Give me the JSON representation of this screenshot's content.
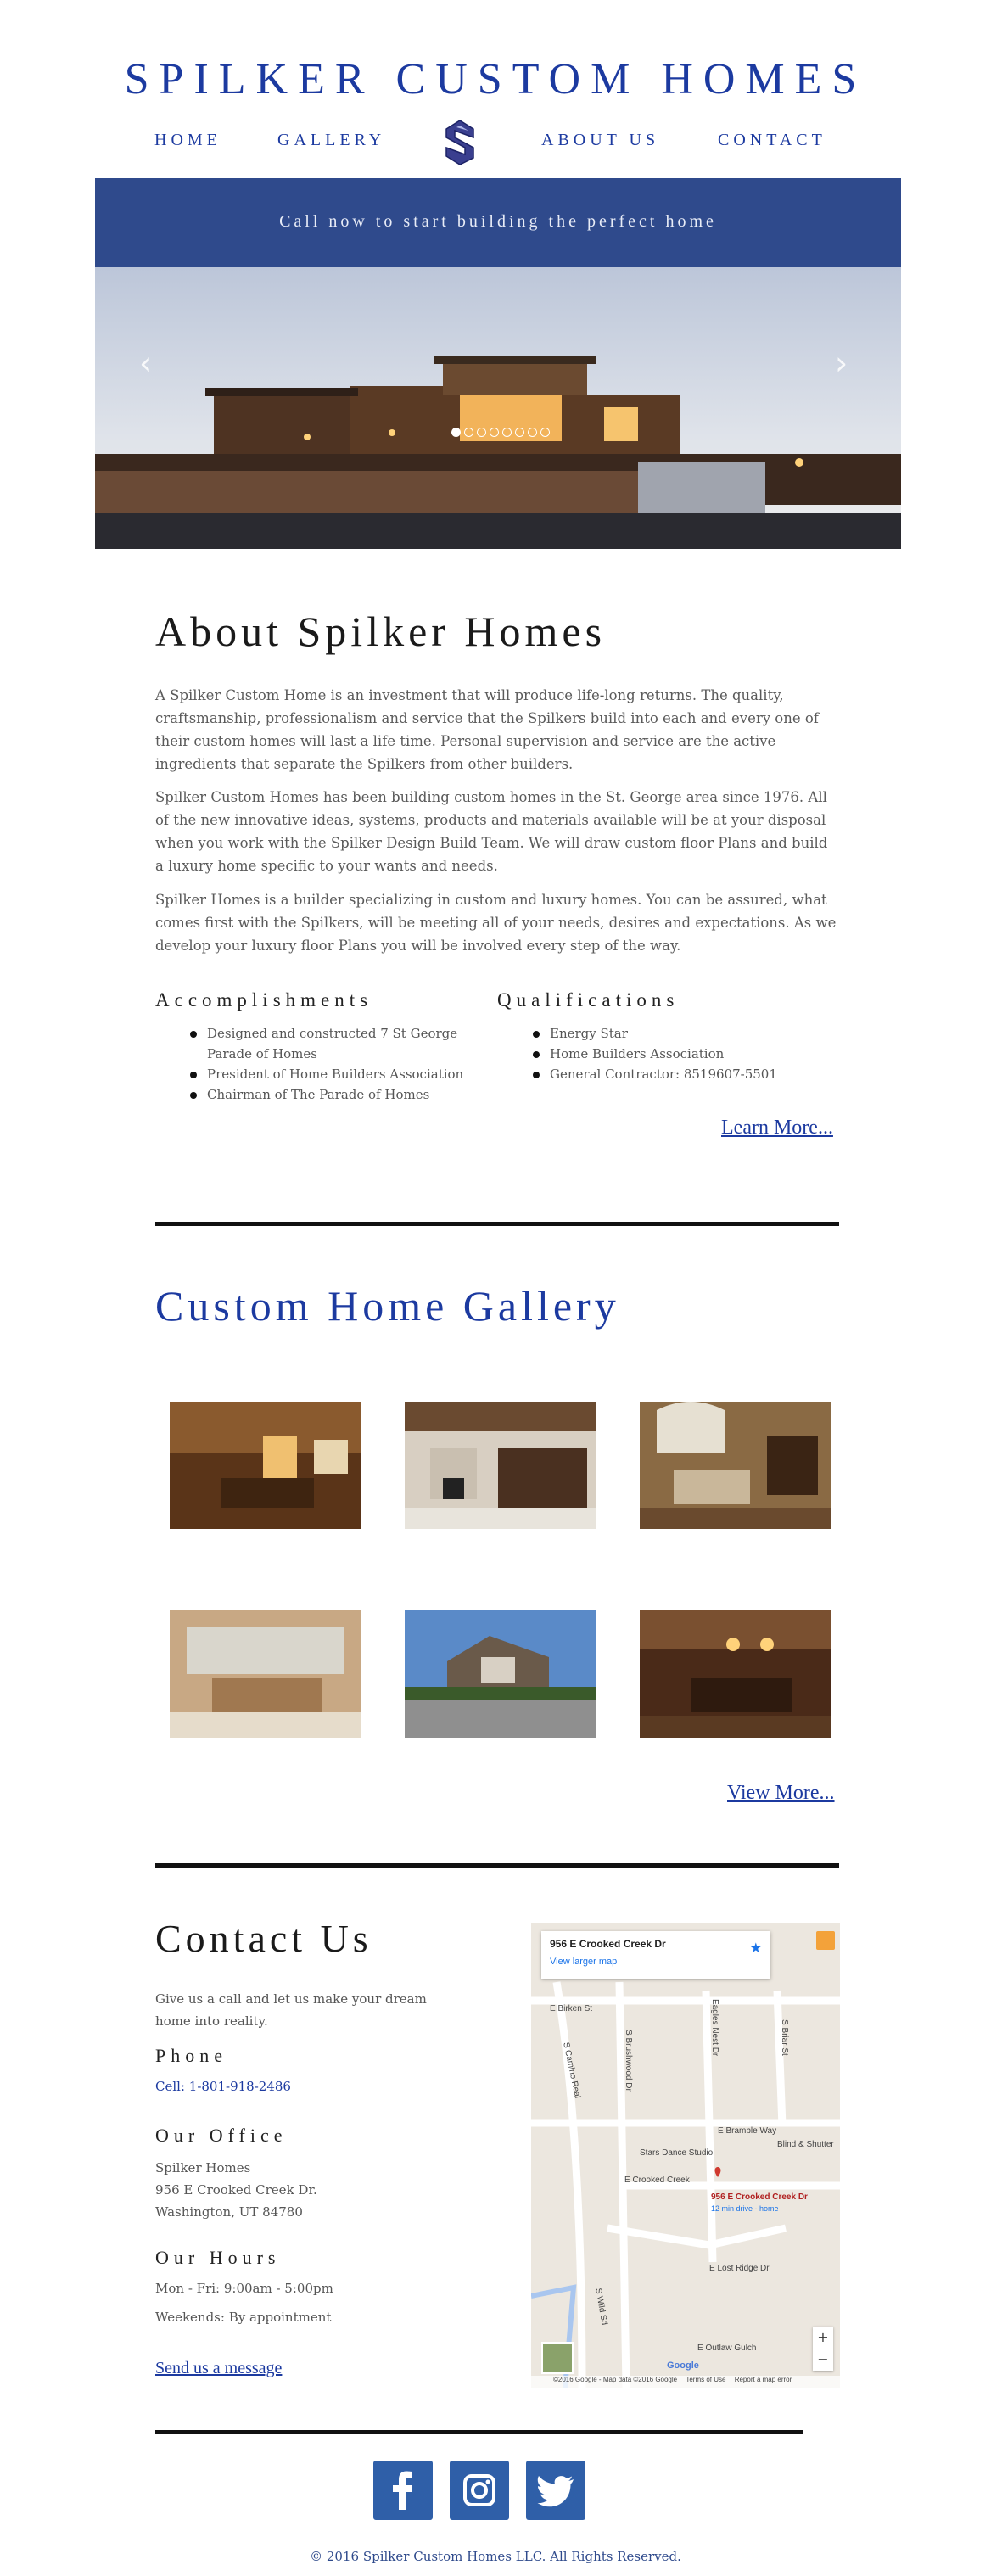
{
  "brand": {
    "title": "SPILKER CUSTOM HOMES"
  },
  "nav": {
    "home": "HOME",
    "gallery": "GALLERY",
    "about": "ABOUT US",
    "contact": "CONTACT"
  },
  "hero": {
    "banner": "Call now to start building the perfect home",
    "slide_count": 8,
    "active_slide": 1
  },
  "about": {
    "title": "About Spilker Homes",
    "p1": "A Spilker Custom Home is an investment that will produce life-long returns. The quality, craftsmanship, professionalism and service that the Spilkers build into each and every one of their custom homes will last a life time. Personal supervision and service are the active ingredients that separate the Spilkers from other builders.",
    "p2": "Spilker Custom Homes has been building custom homes in the St. George area since 1976. All of the new innovative ideas, systems, products and materials available will be at your disposal when you work with the Spilker Design Build Team. We will draw custom floor Plans and build a luxury home specific to your wants and needs.",
    "p3": "Spilker Homes is a builder specializing in custom and luxury homes. You can be assured, what comes first with the Spilkers, will be meeting all of your needs, desires and expectations. As we develop your luxury floor Plans you will be involved every step of the way.",
    "accomplishments_title": "Accomplishments",
    "accomplishments": [
      "Designed and constructed 7 St George Parade of Homes",
      "President of Home Builders Association",
      "Chairman of The Parade of Homes"
    ],
    "qualifications_title": "Qualifications",
    "qualifications": [
      "Energy Star",
      "Home Builders Association",
      "General Contractor: 8519607-5501"
    ],
    "learn_more": "Learn More..."
  },
  "gallery": {
    "title": "Custom Home Gallery",
    "view_more": "View More..."
  },
  "contact": {
    "title": "Contact Us",
    "intro": "Give us a call and let us make your dream home into reality.",
    "phone_title": "Phone",
    "phone": "Cell: 1-801-918-2486",
    "office_title": "Our Office",
    "office_lines": [
      "Spilker Homes",
      "956 E Crooked Creek Dr.",
      "Washington, UT 84780"
    ],
    "hours_title": "Our Hours",
    "hours_weekday": "Mon - Fri: 9:00am - 5:00pm",
    "hours_weekend": "Weekends: By appointment",
    "message_link": "Send us a message"
  },
  "map": {
    "address": "956 E Crooked Creek Dr",
    "larger_map": "View larger map",
    "streets": [
      "E Birken St",
      "S Brushwood Dr",
      "Eagles Nest Dr",
      "S Briar St",
      "E Bramble Way",
      "Stars Dance Studio",
      "Blind & Shutter",
      "E Crooked Creek",
      "S Camino Real",
      "E Lost Ridge Dr",
      "E Outlaw Gulch",
      "S Wild Sd"
    ],
    "marker_label": "956 E Crooked Creek Dr",
    "marker_sub": "12 min drive - home",
    "attribution": "©2016 Google - Map data ©2016 Google",
    "terms": "Terms of Use",
    "report": "Report a map error",
    "google": "Google"
  },
  "footer": {
    "copyright": "© 2016 Spilker Custom Homes LLC. All Rights Reserved."
  },
  "colors": {
    "brand_blue": "#1c3aa0",
    "banner": "#2f4a8c",
    "facebook": "#2f5fa8"
  }
}
